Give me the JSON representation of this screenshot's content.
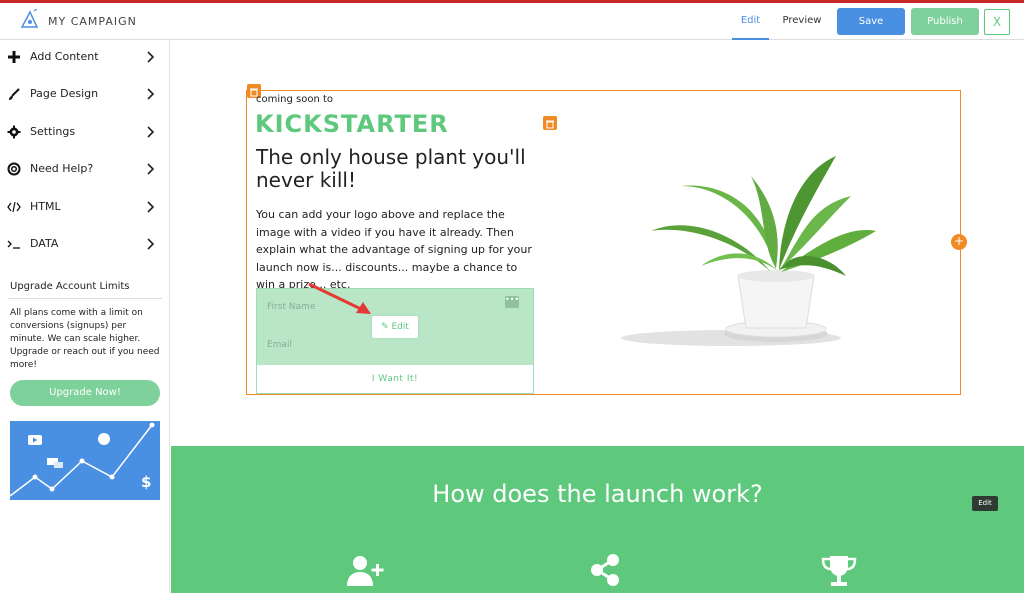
{
  "header": {
    "app_title": "MY CAMPAIGN",
    "tabs": [
      {
        "label": "Edit",
        "active": true
      },
      {
        "label": "Preview",
        "active": false
      }
    ],
    "save_label": "Save",
    "publish_label": "Publish",
    "close_label": "X"
  },
  "sidebar": {
    "items": [
      {
        "label": "Add Content",
        "icon": "plus-icon"
      },
      {
        "label": "Page Design",
        "icon": "brush-icon"
      },
      {
        "label": "Settings",
        "icon": "gear-icon"
      },
      {
        "label": "Need Help?",
        "icon": "lifebuoy-icon"
      },
      {
        "label": "HTML",
        "icon": "code-icon"
      },
      {
        "label": "DATA",
        "icon": "terminal-icon"
      }
    ],
    "upgrade": {
      "title": "Upgrade Account Limits",
      "text": "All plans come with a limit on conversions (signups) per minute. We can scale higher. Upgrade or reach out if you need more!",
      "button_label": "Upgrade Now!"
    }
  },
  "canvas": {
    "coming_soon": "coming soon to",
    "brand": "KICKSTARTER",
    "headline": "The only house plant you'll never kill!",
    "body": "You can add your logo above and replace the image with a video if you have it already. Then explain what the advantage of signing up for your launch now is... discounts... maybe a chance to win a prize... etc.",
    "form": {
      "first_name_placeholder": "First Name",
      "email_placeholder": "Email",
      "submit_label": "I Want It!",
      "edit_chip_label": "Edit"
    },
    "launch_section": {
      "title": "How does the launch work?",
      "edit_tooltip": "Edit"
    }
  },
  "colors": {
    "accent_blue": "#4a90e2",
    "brand_green": "#5ec97d",
    "selection_orange": "#f08a24",
    "top_border_red": "#c62828"
  }
}
